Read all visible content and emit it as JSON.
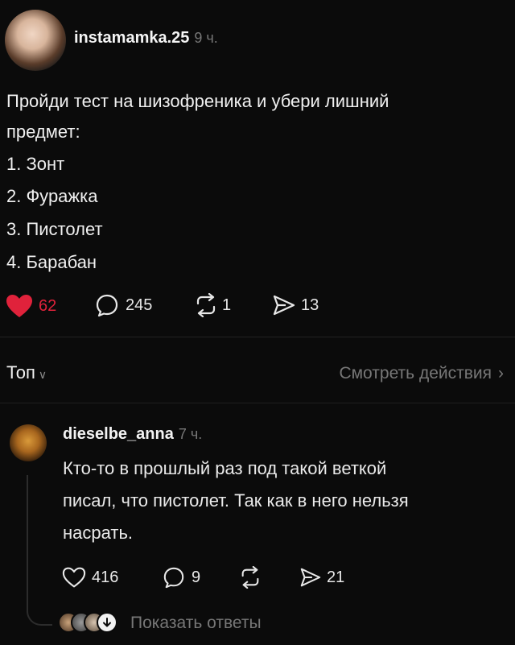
{
  "post": {
    "username": "instamamka.25",
    "time": "9 ч.",
    "lines": [
      "Пройди тест на шизофреника и убери лишний",
      "предмет:",
      "1. Зонт",
      "2. Фуражка",
      "3. Пистолет",
      "4. Барабан"
    ],
    "likes": "62",
    "comments": "245",
    "reposts": "1",
    "shares": "13",
    "like_color": "#e0223b"
  },
  "tabs": {
    "top": "Топ",
    "view_actions": "Смотреть действия"
  },
  "comment": {
    "username": "dieselbe_anna",
    "time": "7 ч.",
    "lines": [
      "Кто-то в прошлый раз под такой веткой",
      "писал, что пистолет. Так как в него нельзя",
      "насрать."
    ],
    "likes": "416",
    "replies": "9",
    "shares": "21",
    "show_replies": "Показать ответы"
  }
}
